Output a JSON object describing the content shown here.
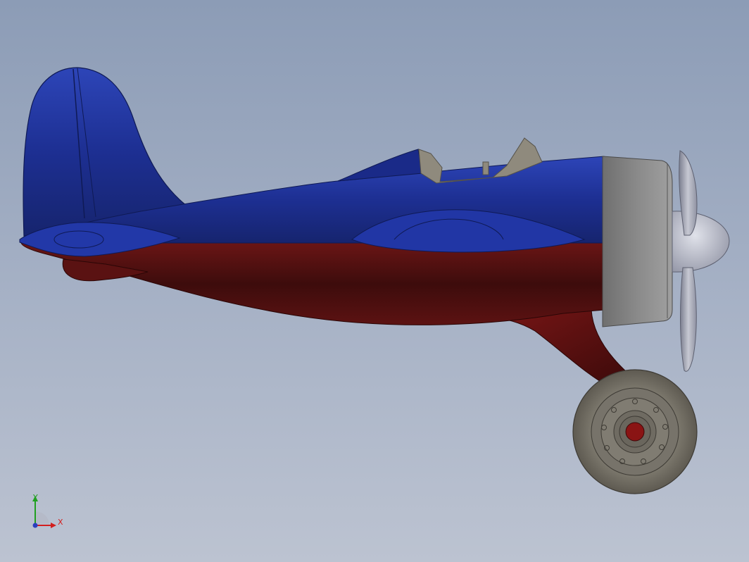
{
  "viewport": {
    "background_top": "#8c9cb6",
    "background_bottom": "#bcc3d1"
  },
  "model": {
    "name": "airplane-model",
    "colors": {
      "upper_body": "#1d2f92",
      "lower_body": "#4a1010",
      "cowling": "#7d7d7d",
      "propeller": "#a9abb8",
      "wheel": "#7a766b",
      "canopy": "#8f8a7d"
    }
  },
  "triad": {
    "x_label": "X",
    "y_label": "Y",
    "x_color": "#d21e1e",
    "y_color": "#20a020",
    "z_color": "#2a3fbf"
  }
}
